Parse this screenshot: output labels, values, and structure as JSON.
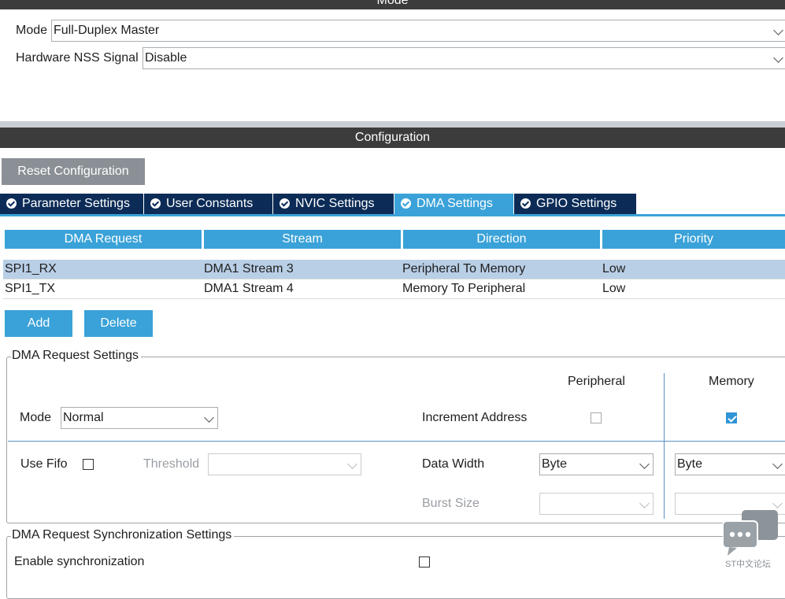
{
  "sections": {
    "mode_title": "Mode",
    "config_title": "Configuration"
  },
  "mode": {
    "mode_label": "Mode",
    "mode_value": "Full-Duplex Master",
    "nss_label": "Hardware NSS Signal",
    "nss_value": "Disable"
  },
  "reset_button": "Reset Configuration",
  "tabs": [
    {
      "label": "Parameter Settings",
      "active": false
    },
    {
      "label": "User Constants",
      "active": false
    },
    {
      "label": "NVIC Settings",
      "active": false
    },
    {
      "label": "DMA Settings",
      "active": true
    },
    {
      "label": "GPIO Settings",
      "active": false
    }
  ],
  "dma_table": {
    "columns": [
      "DMA Request",
      "Stream",
      "Direction",
      "Priority"
    ],
    "rows": [
      {
        "request": "SPI1_RX",
        "stream": "DMA1 Stream 3",
        "direction": "Peripheral To Memory",
        "priority": "Low",
        "selected": true
      },
      {
        "request": "SPI1_TX",
        "stream": "DMA1 Stream 4",
        "direction": "Memory To Peripheral",
        "priority": "Low",
        "selected": false
      }
    ]
  },
  "actions": {
    "add": "Add",
    "delete": "Delete"
  },
  "request_settings": {
    "legend": "DMA Request Settings",
    "peripheral_header": "Peripheral",
    "memory_header": "Memory",
    "mode_label": "Mode",
    "mode_value": "Normal",
    "increment_label": "Increment Address",
    "increment_peripheral": false,
    "increment_memory": true,
    "use_fifo_label": "Use Fifo",
    "use_fifo": false,
    "threshold_label": "Threshold",
    "threshold_value": "",
    "data_width_label": "Data Width",
    "data_width_peripheral": "Byte",
    "data_width_memory": "Byte",
    "burst_size_label": "Burst Size",
    "burst_peripheral": "",
    "burst_memory": ""
  },
  "sync_settings": {
    "legend": "DMA Request Synchronization Settings",
    "enable_label": "Enable synchronization",
    "enabled": false
  },
  "watermark": {
    "text": "ST中文论坛"
  },
  "colors": {
    "header_bar": "#3c3c3c",
    "tab_inactive": "#0c2c57",
    "accent_blue": "#3aa2d8",
    "selected_row": "#b9cfe6",
    "reset_button": "#8b9096"
  }
}
